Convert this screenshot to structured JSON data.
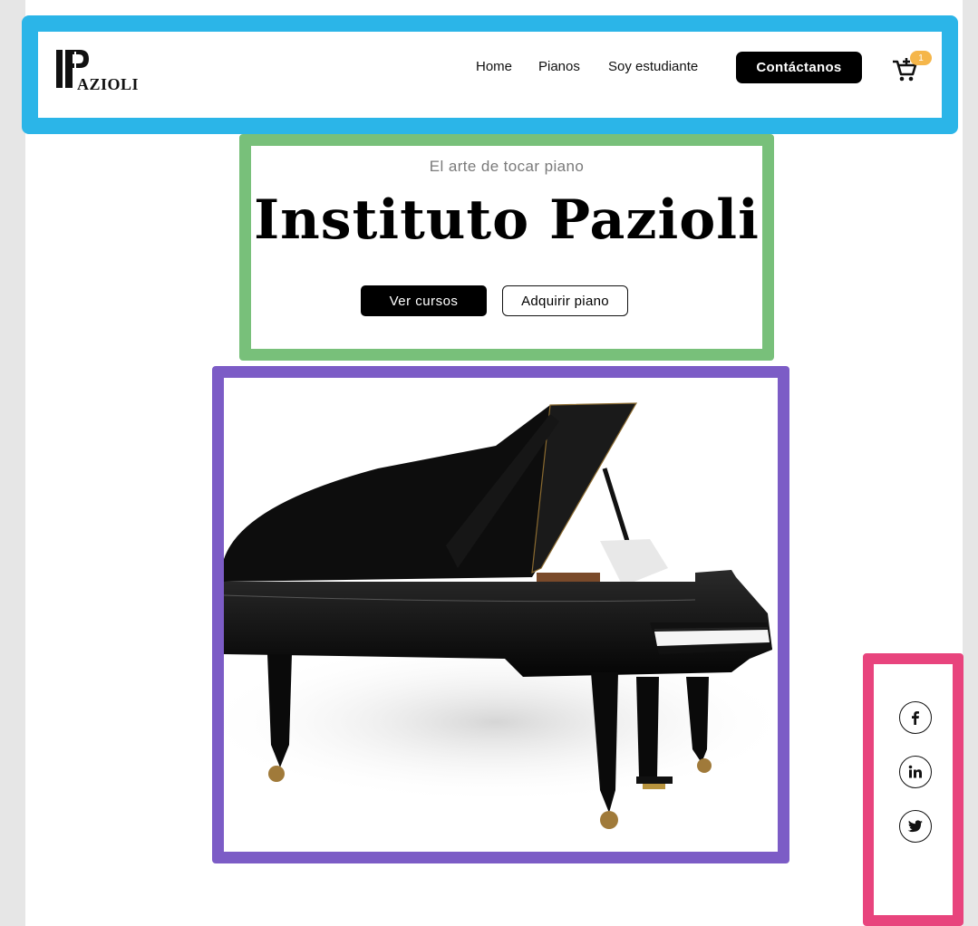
{
  "brand": {
    "logo_text": "AZIOLI"
  },
  "nav": {
    "items": [
      {
        "label": "Home"
      },
      {
        "label": "Pianos"
      },
      {
        "label": "Soy estudiante"
      }
    ],
    "contact_label": "Contáctanos",
    "cart_count": "1"
  },
  "hero": {
    "subtitle": "El arte de tocar piano",
    "title": "Instituto Pazioli",
    "primary_button": "Ver cursos",
    "secondary_button": "Adquirir piano"
  },
  "image": {
    "subject": "grand-piano"
  },
  "social": [
    "facebook-icon",
    "linkedin-icon",
    "twitter-icon"
  ],
  "colors": {
    "annotation_blue": "#2bb5e8",
    "annotation_green": "#78c07a",
    "annotation_purple": "#7c5cc6",
    "annotation_pink": "#e8447d",
    "badge": "#f5b64a"
  }
}
